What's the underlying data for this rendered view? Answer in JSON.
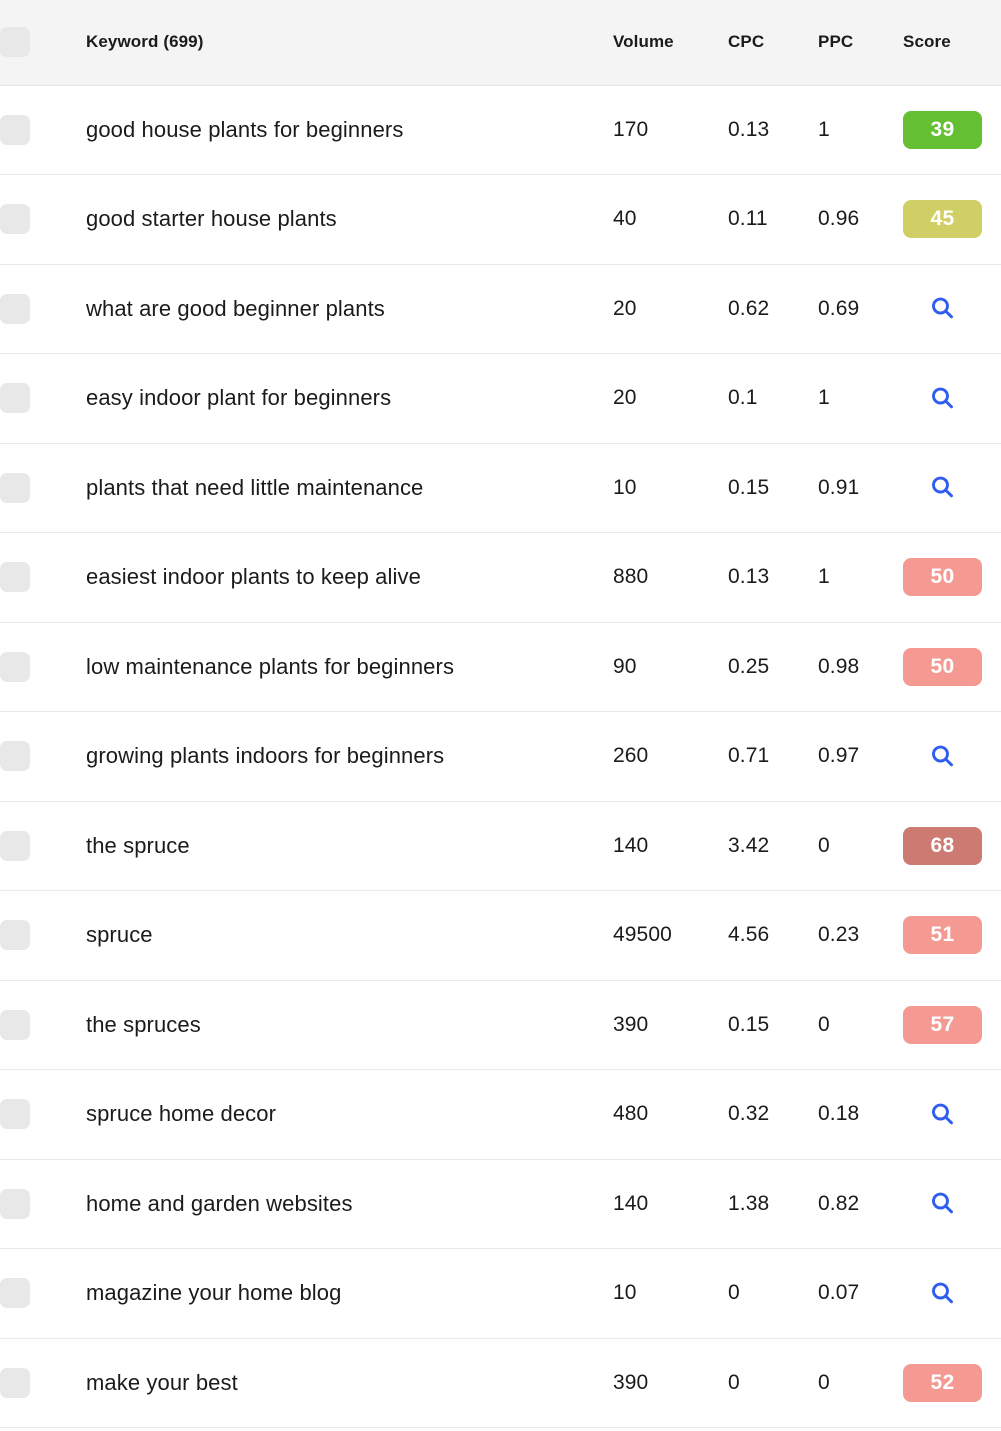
{
  "table": {
    "columns": {
      "checkbox": "",
      "keyword": "Keyword (699)",
      "volume": "Volume",
      "cpc": "CPC",
      "ppc": "PPC",
      "score": "Score"
    },
    "keyword_count": 699,
    "select_all_checkbox": "unchecked",
    "colors": {
      "header_bg": "#f4f4f4",
      "row_bg": "#ffffff",
      "row_divider": "#eaeaea",
      "checkbox_bg": "#e8e8e8",
      "text": "#1b1b1b",
      "search_icon_blue": "#2f5def",
      "score_green": "#65bf33",
      "score_khaki": "#d0cf66",
      "score_salmon": "#f59a93",
      "score_dark_red": "#cc7a72"
    },
    "rows": [
      {
        "checkbox": "unchecked",
        "keyword": "good house plants for beginners",
        "volume": "170",
        "cpc": "0.13",
        "ppc": "1",
        "score": "39",
        "score_color": "#65bf33",
        "score_type": "badge"
      },
      {
        "checkbox": "unchecked",
        "keyword": "good starter house plants",
        "volume": "40",
        "cpc": "0.11",
        "ppc": "0.96",
        "score": "45",
        "score_color": "#d0cf66",
        "score_type": "badge"
      },
      {
        "checkbox": "unchecked",
        "keyword": "what are good beginner plants",
        "volume": "20",
        "cpc": "0.62",
        "ppc": "0.69",
        "score": "",
        "score_color": "#2f5def",
        "score_type": "search"
      },
      {
        "checkbox": "unchecked",
        "keyword": "easy indoor plant for beginners",
        "volume": "20",
        "cpc": "0.1",
        "ppc": "1",
        "score": "",
        "score_color": "#2f5def",
        "score_type": "search"
      },
      {
        "checkbox": "unchecked",
        "keyword": "plants that need little maintenance",
        "volume": "10",
        "cpc": "0.15",
        "ppc": "0.91",
        "score": "",
        "score_color": "#2f5def",
        "score_type": "search"
      },
      {
        "checkbox": "unchecked",
        "keyword": "easiest indoor plants to keep alive",
        "volume": "880",
        "cpc": "0.13",
        "ppc": "1",
        "score": "50",
        "score_color": "#f59a93",
        "score_type": "badge"
      },
      {
        "checkbox": "unchecked",
        "keyword": "low maintenance plants for beginners",
        "volume": "90",
        "cpc": "0.25",
        "ppc": "0.98",
        "score": "50",
        "score_color": "#f59a93",
        "score_type": "badge"
      },
      {
        "checkbox": "unchecked",
        "keyword": "growing plants indoors for beginners",
        "volume": "260",
        "cpc": "0.71",
        "ppc": "0.97",
        "score": "",
        "score_color": "#2f5def",
        "score_type": "search"
      },
      {
        "checkbox": "unchecked",
        "keyword": "the spruce",
        "volume": "140",
        "cpc": "3.42",
        "ppc": "0",
        "score": "68",
        "score_color": "#cc7a72",
        "score_type": "badge"
      },
      {
        "checkbox": "unchecked",
        "keyword": "spruce",
        "volume": "49500",
        "cpc": "4.56",
        "ppc": "0.23",
        "score": "51",
        "score_color": "#f59a93",
        "score_type": "badge"
      },
      {
        "checkbox": "unchecked",
        "keyword": "the spruces",
        "volume": "390",
        "cpc": "0.15",
        "ppc": "0",
        "score": "57",
        "score_color": "#f59a93",
        "score_type": "badge"
      },
      {
        "checkbox": "unchecked",
        "keyword": "spruce home decor",
        "volume": "480",
        "cpc": "0.32",
        "ppc": "0.18",
        "score": "",
        "score_color": "#2f5def",
        "score_type": "search"
      },
      {
        "checkbox": "unchecked",
        "keyword": "home and garden websites",
        "volume": "140",
        "cpc": "1.38",
        "ppc": "0.82",
        "score": "",
        "score_color": "#2f5def",
        "score_type": "search"
      },
      {
        "checkbox": "unchecked",
        "keyword": "magazine your home blog",
        "volume": "10",
        "cpc": "0",
        "ppc": "0.07",
        "score": "",
        "score_color": "#2f5def",
        "score_type": "search"
      },
      {
        "checkbox": "unchecked",
        "keyword": "make your best",
        "volume": "390",
        "cpc": "0",
        "ppc": "0",
        "score": "52",
        "score_color": "#f59a93",
        "score_type": "badge"
      }
    ]
  }
}
